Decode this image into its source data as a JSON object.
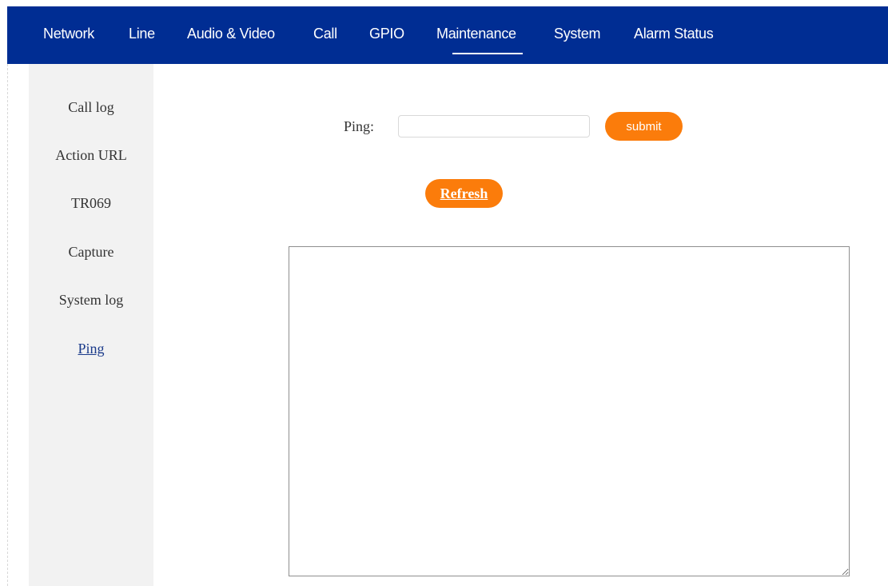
{
  "topnav": {
    "items": [
      {
        "label": "Network"
      },
      {
        "label": "Line"
      },
      {
        "label": "Audio & Video"
      },
      {
        "label": "Call"
      },
      {
        "label": "GPIO"
      },
      {
        "label": "Maintenance",
        "active": true
      },
      {
        "label": "System"
      },
      {
        "label": "Alarm Status"
      }
    ]
  },
  "sidebar": {
    "items": [
      {
        "label": "Call log"
      },
      {
        "label": "Action URL"
      },
      {
        "label": "TR069"
      },
      {
        "label": "Capture"
      },
      {
        "label": "System log"
      },
      {
        "label": "Ping",
        "active": true
      }
    ]
  },
  "ping": {
    "label": "Ping:",
    "value": "",
    "placeholder": "",
    "submit_label": "submit",
    "refresh_label": "Refresh",
    "output": ""
  },
  "colors": {
    "nav_bg": "#002d93",
    "accent_orange": "#fb7c0b",
    "sidebar_bg": "#f2f2f2",
    "active_link": "#1a3a8a"
  }
}
